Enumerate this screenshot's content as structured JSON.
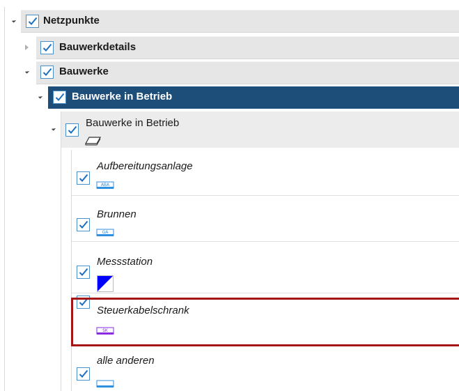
{
  "tree": {
    "netzpunkte": {
      "label": "Netzpunkte",
      "checked": true,
      "expanded": true
    },
    "bauwerkdetails": {
      "label": "Bauwerkdetails",
      "checked": true,
      "expanded": false
    },
    "bauwerke": {
      "label": "Bauwerke",
      "checked": true,
      "expanded": true
    },
    "in_betrieb_group": {
      "label": "Bauwerke in Betrieb",
      "checked": true,
      "expanded": true,
      "selected": true
    },
    "in_betrieb_layer": {
      "label": "Bauwerke in Betrieb",
      "checked": true,
      "expanded": true,
      "icon": "layer-icon"
    },
    "classes": [
      {
        "label": "Aufbereitungsanlage",
        "checked": true,
        "symbol_text": "ABA",
        "symbol_color": "#2f8fe0",
        "icon": "aba-symbol-icon"
      },
      {
        "label": "Brunnen",
        "checked": true,
        "symbol_text": "GA",
        "symbol_color": "#2f8fe0",
        "icon": "ga-symbol-icon"
      },
      {
        "label": "Messstation",
        "checked": true,
        "symbol_color": "#0000ff",
        "icon": "triangle-symbol-icon"
      },
      {
        "label": "Steuerkabelschrank",
        "checked": true,
        "symbol_text": "SK",
        "symbol_color": "#8a2be2",
        "icon": "sk-symbol-icon",
        "highlighted": true
      },
      {
        "label": "alle anderen",
        "checked": true,
        "symbol_color": "#2f8fe0",
        "icon": "default-symbol-icon"
      }
    ]
  },
  "colors": {
    "selected_row": "#1d4e79",
    "highlight_border": "#a51414",
    "checkbox_border": "#4a90c8",
    "checkmark": "#1e6fbf"
  }
}
